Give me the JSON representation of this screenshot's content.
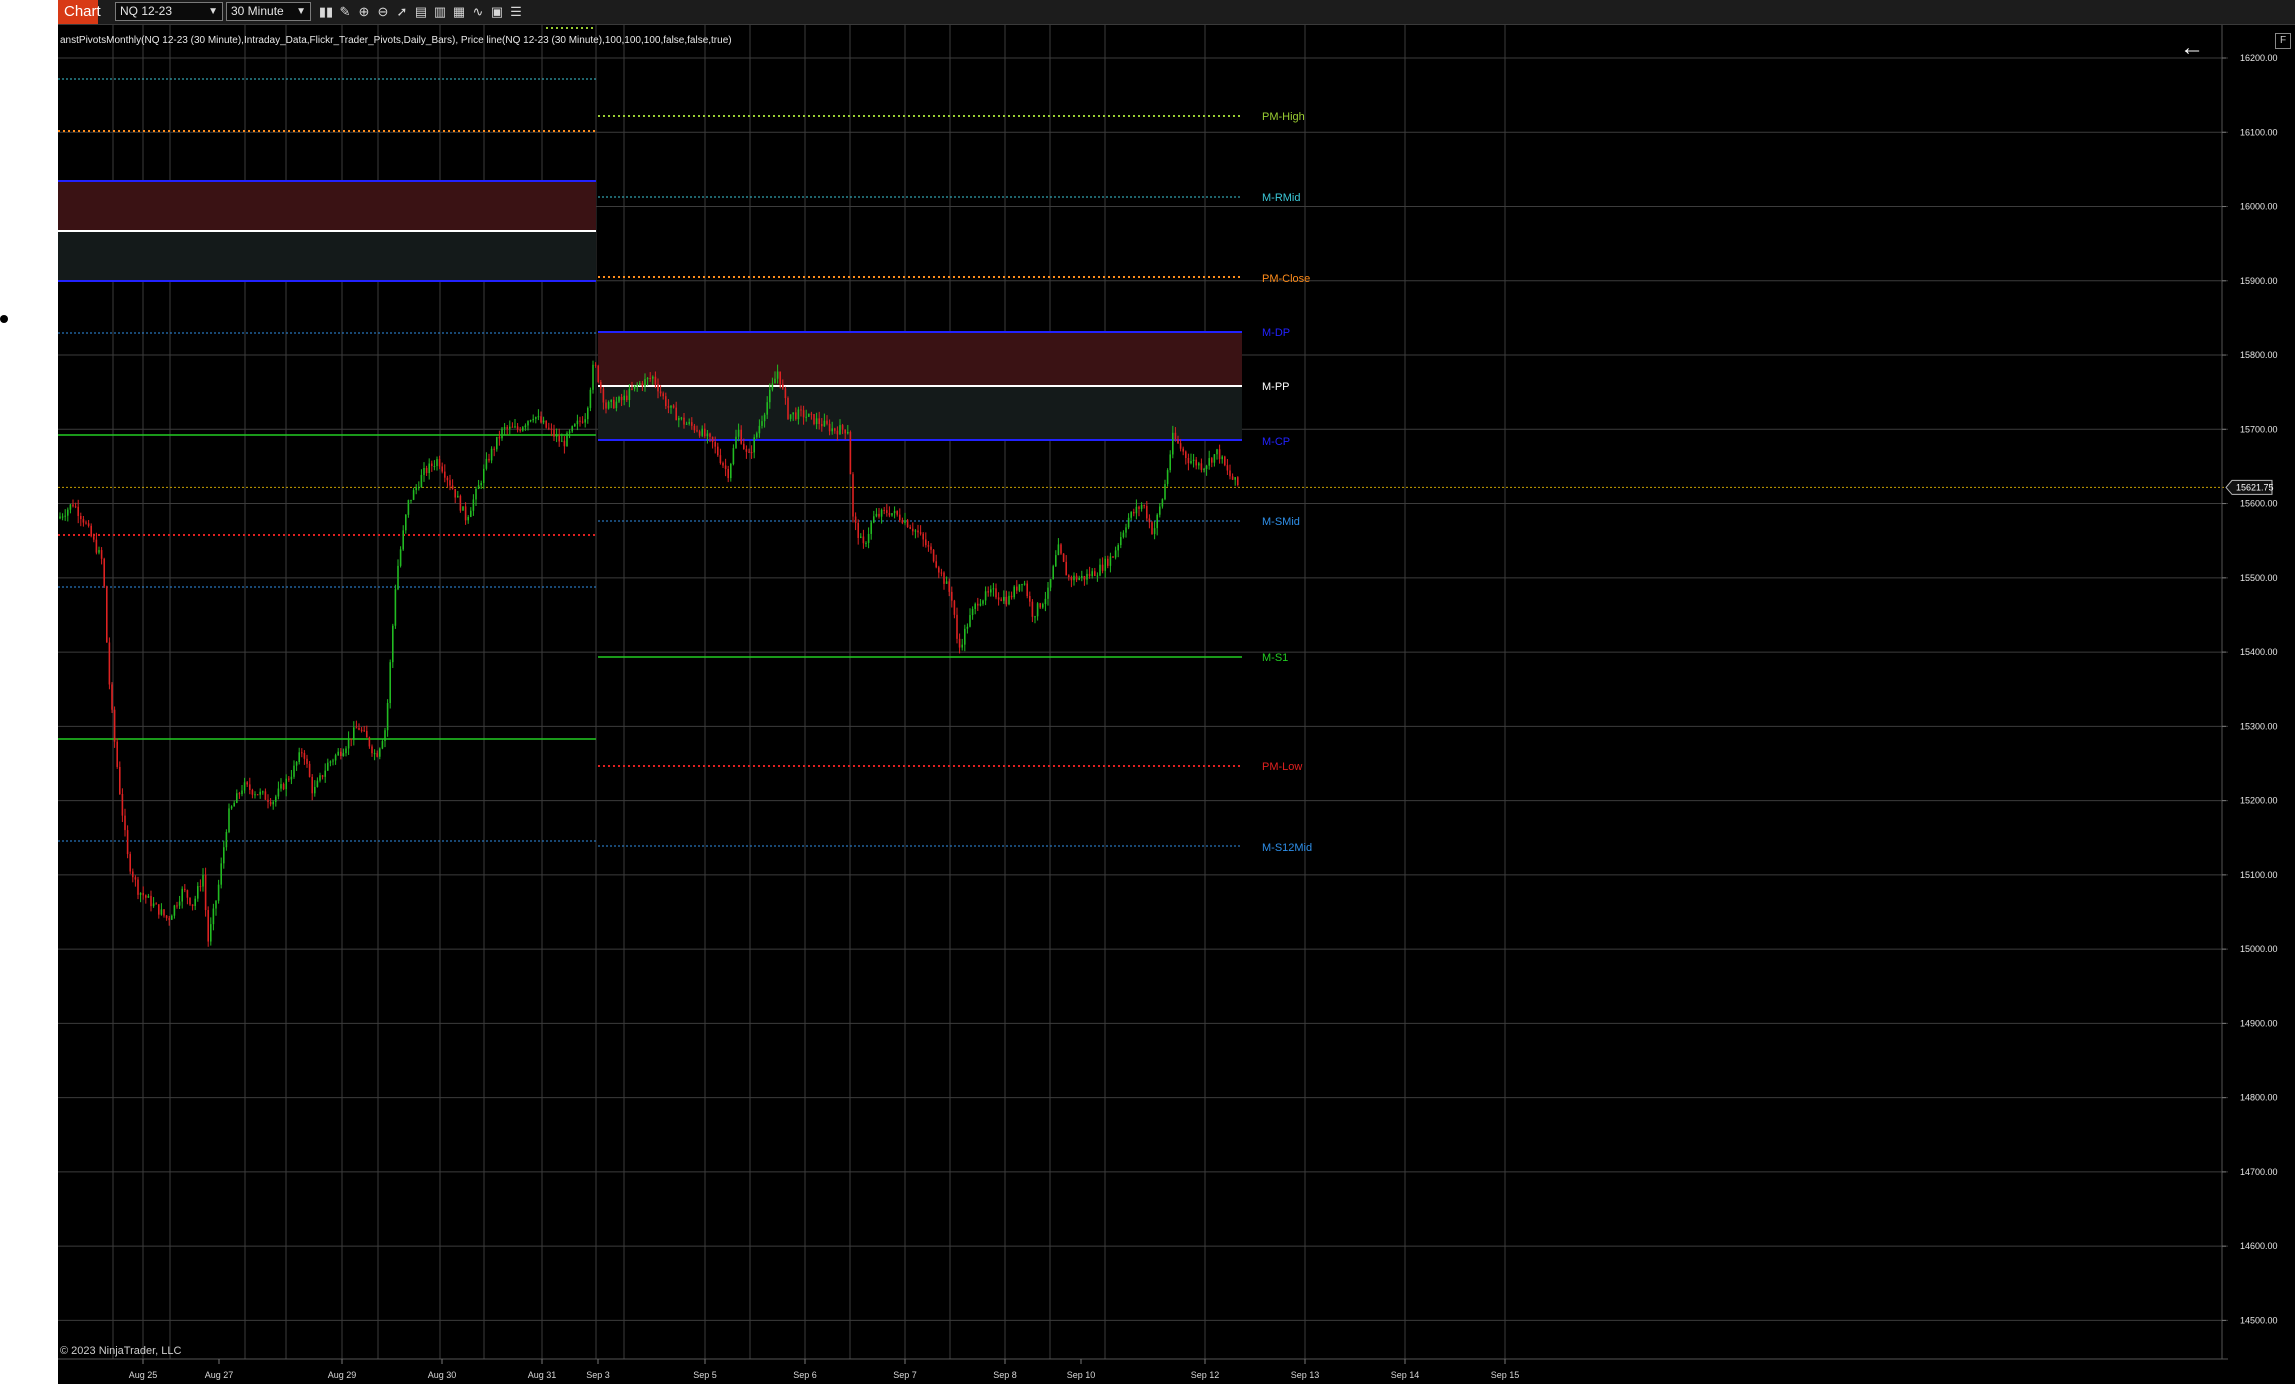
{
  "toolbar": {
    "chart_tab": "Chart",
    "instrument": "NQ 12-23",
    "interval": "30 Minute",
    "icons": [
      "bar-chart-style-icon",
      "pencil-icon",
      "zoom-in-icon",
      "zoom-out-icon",
      "cursor-icon",
      "data-box-icon",
      "properties-icon",
      "strategies-icon",
      "indicators-icon",
      "templates-icon",
      "more-menu-icon"
    ]
  },
  "indicator_label": "anstPivotsMonthly(NQ 12-23 (30 Minute),Intraday_Data,Flickr_Trader_Pivots,Daily_Bars), Price line(NQ 12-23 (30 Minute),100,100,100,false,false,true)",
  "copyright": "© 2023 NinjaTrader, LLC",
  "panel_button": "F",
  "price_axis": {
    "ticks": [
      "16200.00",
      "16100.00",
      "16000.00",
      "15900.00",
      "15800.00",
      "15700.00",
      "15600.00",
      "15500.00",
      "15400.00",
      "15300.00",
      "15200.00",
      "15100.00",
      "15000.00",
      "14900.00",
      "14800.00",
      "14700.00",
      "14600.00",
      "14500.00"
    ],
    "current_price": "15621.75"
  },
  "time_axis": {
    "ticks": [
      "Aug 25",
      "Aug 27",
      "Aug 29",
      "Aug 30",
      "Aug 31",
      "Sep 3",
      "Sep 5",
      "Sep 6",
      "Sep 7",
      "Sep 8",
      "Sep 10",
      "Sep 12",
      "Sep 13",
      "Sep 14",
      "Sep 15"
    ]
  },
  "pivot_labels": [
    {
      "text": "PM-High",
      "color": "#9acd32"
    },
    {
      "text": "M-RMid",
      "color": "#3cc8d8"
    },
    {
      "text": "PM-Close",
      "color": "#ff8c1a"
    },
    {
      "text": "M-DP",
      "color": "#2222ff"
    },
    {
      "text": "M-PP",
      "color": "#ffffff"
    },
    {
      "text": "M-CP",
      "color": "#2222ff"
    },
    {
      "text": "M-SMid",
      "color": "#2f8fe8"
    },
    {
      "text": "M-S1",
      "color": "#22cc22"
    },
    {
      "text": "PM-Low",
      "color": "#e02020"
    },
    {
      "text": "M-S12Mid",
      "color": "#2f8fe8"
    }
  ],
  "colors": {
    "up_candle": "#22bb22",
    "down_candle": "#dd2222",
    "zone_upper": "#3a1214",
    "zone_lower": "#141a1a",
    "grid": "#3c3c3c"
  }
}
